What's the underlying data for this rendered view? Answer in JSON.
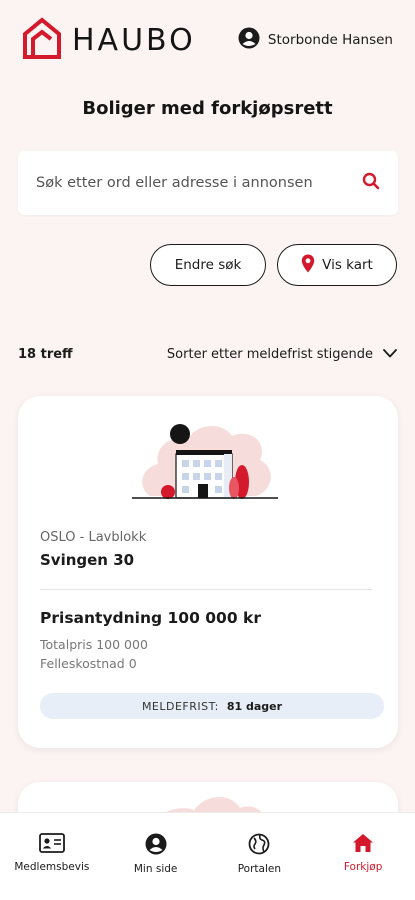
{
  "header": {
    "logo_text": "HAUBO",
    "user_name": "Storbonde Hansen"
  },
  "page_title": "Boliger med forkjøpsrett",
  "search": {
    "placeholder": "Søk etter ord eller adresse i annonsen"
  },
  "actions": {
    "edit_search": "Endre søk",
    "show_map": "Vis kart"
  },
  "results": {
    "count_label": "18 treff",
    "sort_label": "Sorter etter meldefrist stigende"
  },
  "listing": {
    "location_type": "OSLO - Lavblokk",
    "address": "Svingen 30",
    "price_label": "Prisantydning 100 000 kr",
    "total_price": "Totalpris 100 000",
    "shared_cost": "Felleskostnad 0",
    "deadline_label": "MELDEFRIST:",
    "deadline_value": "81 dager"
  },
  "nav": {
    "items": [
      {
        "label": "Medlemsbevis",
        "icon": "id-card-icon"
      },
      {
        "label": "Min side",
        "icon": "person-icon"
      },
      {
        "label": "Portalen",
        "icon": "globe-icon"
      },
      {
        "label": "Forkjøp",
        "icon": "home-icon"
      }
    ],
    "active_index": 3
  },
  "colors": {
    "accent": "#d4192c",
    "background": "#fbf4f2",
    "deadline_bg": "#e8eef7"
  }
}
